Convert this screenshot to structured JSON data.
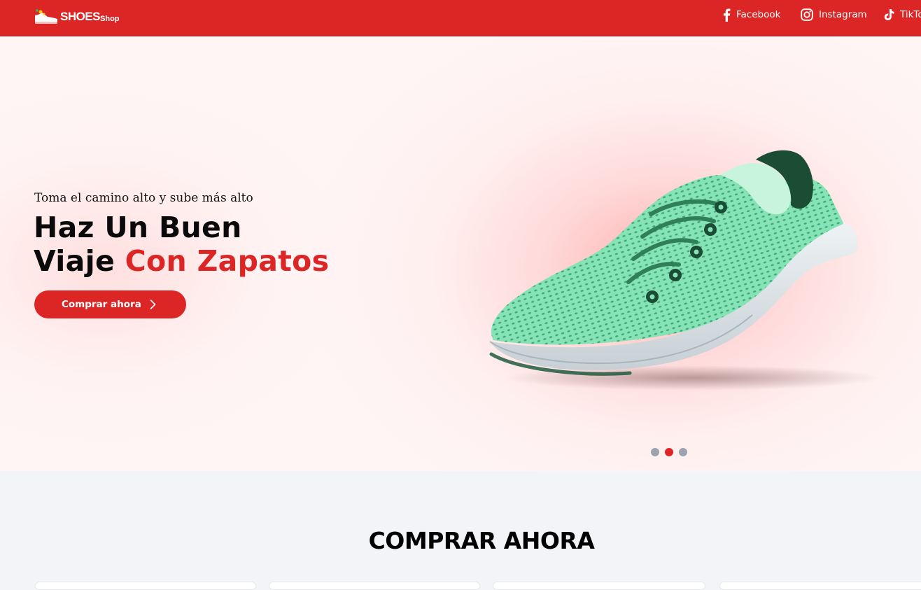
{
  "header": {
    "logo_text": "SHOES",
    "logo_sub": "Shop",
    "social": [
      {
        "label": "Facebook",
        "icon": "facebook-icon"
      },
      {
        "label": "Instagram",
        "icon": "instagram-icon"
      },
      {
        "label": "TikTok",
        "icon": "tiktok-icon"
      }
    ]
  },
  "hero": {
    "tagline": "Toma el camino alto y sube más alto",
    "headline_line1": "Haz Un Buen",
    "headline_line2_a": "Viaje ",
    "headline_line2_b": "Con Zapatos",
    "cta_label": "Comprar ahora",
    "slide_count": 3,
    "active_slide": 2
  },
  "section": {
    "title": "COMPRAR AHORA"
  },
  "colors": {
    "brand": "#dc2626",
    "headline": "#0a0a0a",
    "background": "#f2f4f8",
    "shoe_upper": "#7fe0b0",
    "shoe_sole": "#dfe6ea",
    "shoe_laces": "#1f5a3c"
  }
}
